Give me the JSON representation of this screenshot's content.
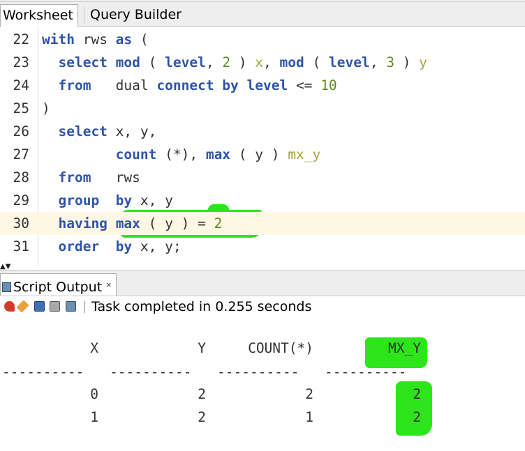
{
  "tabs": {
    "worksheet": "Worksheet",
    "query_builder": "Query Builder"
  },
  "editor": {
    "lines": [
      {
        "n": "22",
        "tokens": [
          [
            "kw",
            "with"
          ],
          [
            "txt",
            " rws "
          ],
          [
            "kw",
            "as"
          ],
          [
            "txt",
            " ("
          ]
        ]
      },
      {
        "n": "23",
        "tokens": [
          [
            "txt",
            "  "
          ],
          [
            "kw",
            "select mod"
          ],
          [
            "txt",
            " ( "
          ],
          [
            "kw",
            "level"
          ],
          [
            "txt",
            ", "
          ],
          [
            "num",
            "2"
          ],
          [
            "txt",
            " ) "
          ],
          [
            "alias",
            "x"
          ],
          [
            "txt",
            ", "
          ],
          [
            "kw",
            "mod"
          ],
          [
            "txt",
            " ( "
          ],
          [
            "kw",
            "level"
          ],
          [
            "txt",
            ", "
          ],
          [
            "num",
            "3"
          ],
          [
            "txt",
            " ) "
          ],
          [
            "alias",
            "y"
          ]
        ]
      },
      {
        "n": "24",
        "tokens": [
          [
            "txt",
            "  "
          ],
          [
            "kw",
            "from"
          ],
          [
            "txt",
            "   dual "
          ],
          [
            "kw",
            "connect by level"
          ],
          [
            "txt",
            " <= "
          ],
          [
            "num",
            "10"
          ]
        ]
      },
      {
        "n": "25",
        "tokens": [
          [
            "txt",
            ")"
          ]
        ]
      },
      {
        "n": "26",
        "tokens": [
          [
            "txt",
            "  "
          ],
          [
            "kw",
            "select"
          ],
          [
            "txt",
            " x, y,"
          ]
        ]
      },
      {
        "n": "27",
        "tokens": [
          [
            "txt",
            "         "
          ],
          [
            "kw",
            "count"
          ],
          [
            "txt",
            " (*), "
          ],
          [
            "kw",
            "max"
          ],
          [
            "txt",
            " ( y ) "
          ],
          [
            "alias",
            "mx_y"
          ]
        ]
      },
      {
        "n": "28",
        "tokens": [
          [
            "txt",
            "  "
          ],
          [
            "kw",
            "from"
          ],
          [
            "txt",
            "   rws"
          ]
        ]
      },
      {
        "n": "29",
        "tokens": [
          [
            "txt",
            "  "
          ],
          [
            "kw",
            "group"
          ],
          [
            "txt",
            "  "
          ],
          [
            "kw",
            "by"
          ],
          [
            "txt",
            " x, y"
          ]
        ]
      },
      {
        "n": "30",
        "tokens": [
          [
            "txt",
            "  "
          ],
          [
            "kw",
            "having"
          ],
          [
            "txt",
            " "
          ],
          [
            "kw",
            "max"
          ],
          [
            "txt",
            " ( y ) = "
          ],
          [
            "num",
            "2"
          ]
        ]
      },
      {
        "n": "31",
        "tokens": [
          [
            "txt",
            "  "
          ],
          [
            "kw",
            "order"
          ],
          [
            "txt",
            "  "
          ],
          [
            "kw",
            "by"
          ],
          [
            "txt",
            " x, y;"
          ]
        ]
      }
    ],
    "current_line": "30"
  },
  "output": {
    "tab_label": "Script Output",
    "close_glyph": "×",
    "status": "Task completed in 0.255 seconds",
    "columns": [
      "X",
      "Y",
      "COUNT(*)",
      "MX_Y"
    ],
    "rows": [
      [
        "0",
        "2",
        "2",
        "2"
      ],
      [
        "1",
        "2",
        "1",
        "2"
      ]
    ]
  },
  "icons": {
    "pin": "pin-icon",
    "eraser": "eraser-icon",
    "save": "save-icon",
    "print": "print-icon",
    "file": "file-icon"
  },
  "colors": {
    "keyword": "#2f54a6",
    "number": "#5f8a1e",
    "alias": "#a7a33a",
    "highlight": "#2ee51b"
  }
}
